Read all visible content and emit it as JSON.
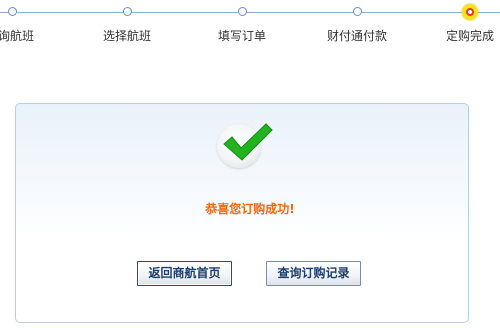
{
  "steps": [
    {
      "label": "询航班"
    },
    {
      "label": "选择航班"
    },
    {
      "label": "填写订单"
    },
    {
      "label": "财付通付款"
    },
    {
      "label": "定购完成",
      "current": true
    }
  ],
  "result": {
    "message": "恭喜您订购成功!",
    "icon": "check-icon"
  },
  "buttons": {
    "home": "返回商航首页",
    "orders": "查询订购记录"
  },
  "colors": {
    "message": "#ec6a14",
    "check": "#22b41f",
    "current_step": "#f8e21c"
  }
}
